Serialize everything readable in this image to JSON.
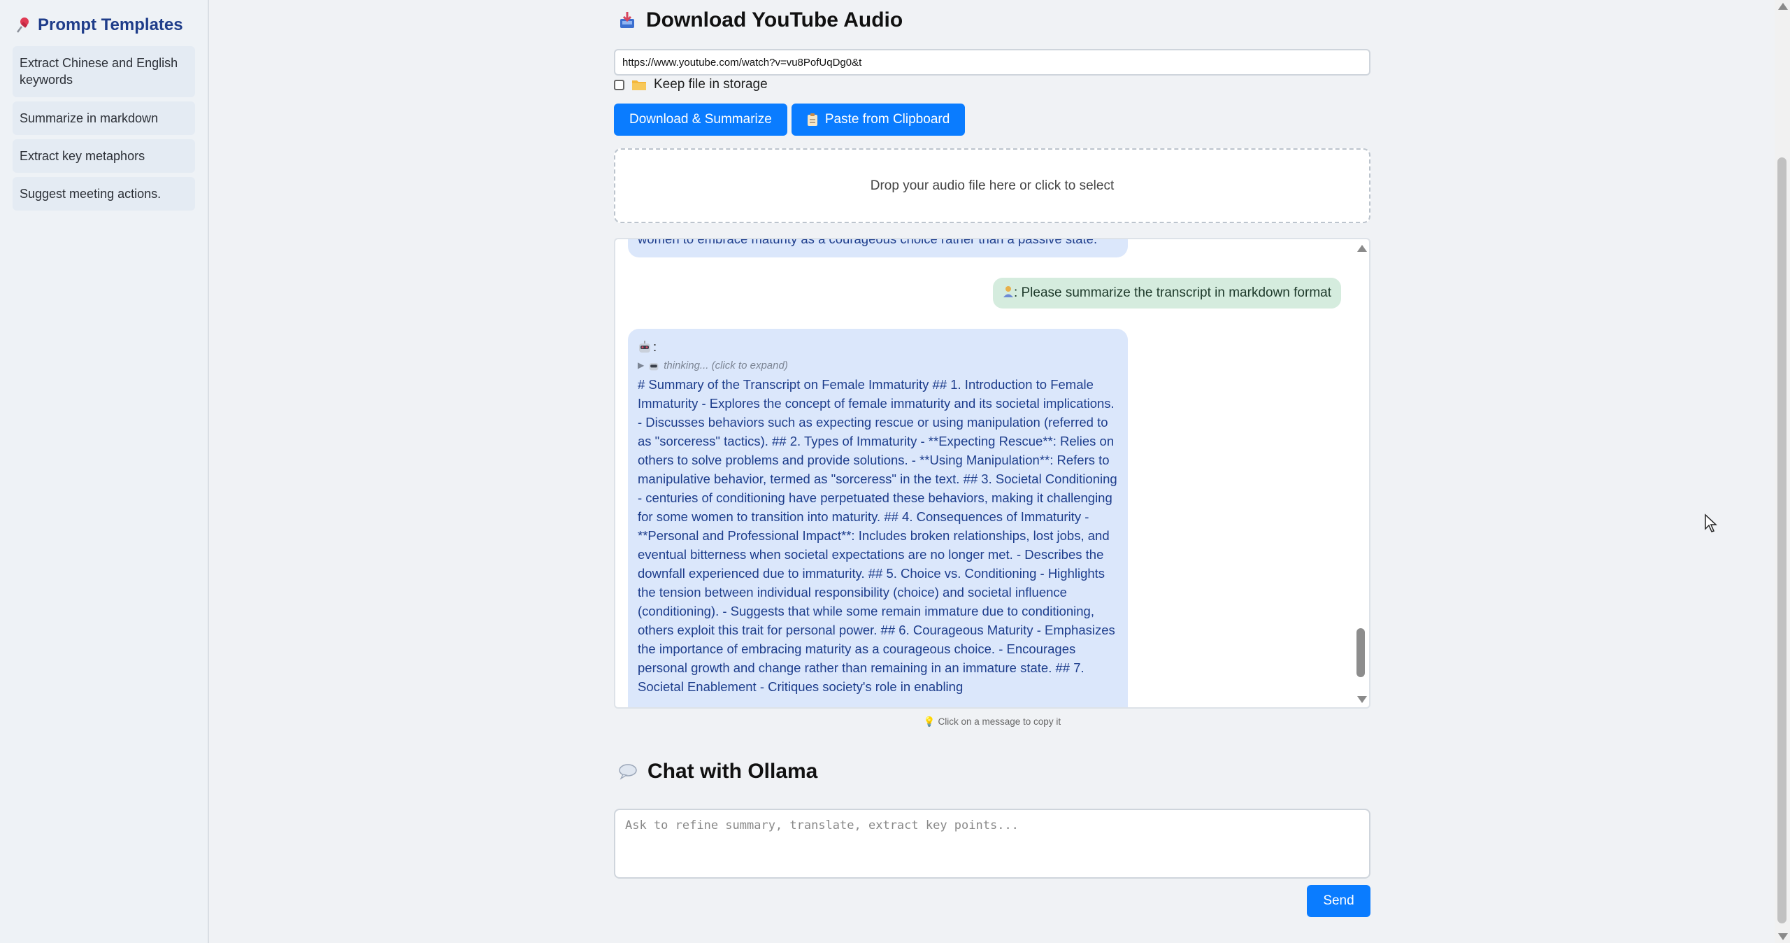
{
  "sidebar": {
    "title": "Prompt Templates",
    "items": [
      {
        "label": "Extract Chinese and English keywords"
      },
      {
        "label": "Summarize in markdown"
      },
      {
        "label": "Extract key metaphors"
      },
      {
        "label": "Suggest meeting actions."
      }
    ]
  },
  "download": {
    "title": "Download YouTube Audio",
    "url_value": "https://www.youtube.com/watch?v=vu8PofUqDg0&t",
    "keep_label": "Keep file in storage",
    "download_button": "Download & Summarize",
    "paste_button": "Paste from Clipboard",
    "dropzone_text": "Drop your audio file here or click to select"
  },
  "messages": {
    "previous_ai_tail": "women to embrace maturity as a courageous choice rather than a passive state.",
    "user": ": Please summarize the transcript in markdown format",
    "ai_prefix": ":",
    "thinking": "thinking... (click to expand)",
    "ai_body": "# Summary of the Transcript on Female Immaturity ## 1. Introduction to Female Immaturity - Explores the concept of female immaturity and its societal implications. - Discusses behaviors such as expecting rescue or using manipulation (referred to as \"sorceress\" tactics). ## 2. Types of Immaturity - **Expecting Rescue**: Relies on others to solve problems and provide solutions. - **Using Manipulation**: Refers to manipulative behavior, termed as \"sorceress\" in the text. ## 3. Societal Conditioning - centuries of conditioning have perpetuated these behaviors, making it challenging for some women to transition into maturity. ## 4. Consequences of Immaturity - **Personal and Professional Impact**: Includes broken relationships, lost jobs, and eventual bitterness when societal expectations are no longer met. - Describes the downfall experienced due to immaturity. ## 5. Choice vs. Conditioning - Highlights the tension between individual responsibility (choice) and societal influence (conditioning). - Suggests that while some remain immature due to conditioning, others exploit this trait for personal power. ## 6. Courageous Maturity - Emphasizes the importance of embracing maturity as a courageous choice. - Encourages personal growth and change rather than remaining in an immature state. ## 7. Societal Enablement - Critiques society's role in enabling"
  },
  "copy_hint": "Click on a message to copy it",
  "chat": {
    "title": "Chat with Ollama",
    "placeholder": "Ask to refine summary, translate, extract key points...",
    "send_label": "Send"
  },
  "colors": {
    "accent": "#0a7cff",
    "sidebar_title": "#1f3d8a",
    "ai_bubble": "#dbe7fb",
    "user_bubble": "#d5ecde"
  },
  "icons": {
    "sidebar": "pushpin-icon",
    "download": "inbox-tray-icon",
    "folder": "folder-icon",
    "paste": "clipboard-icon",
    "chat": "speech-balloon-icon",
    "hint": "light-bulb-icon"
  }
}
